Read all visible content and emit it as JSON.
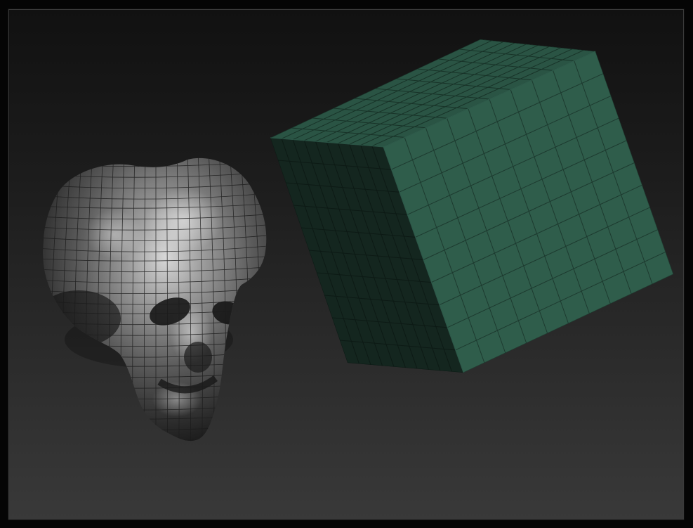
{
  "viewport": {
    "background_top": "#111111",
    "background_bottom": "#393939"
  },
  "scene": {
    "objects": [
      {
        "name": "skull-mesh",
        "material": "metallic-grey-matcap",
        "wireframe": true,
        "color": "#8a8a8a"
      },
      {
        "name": "cube-mesh",
        "material": "teal-flat",
        "wireframe": true,
        "subdivisions": 10,
        "color": "#2f5f4c"
      }
    ]
  }
}
